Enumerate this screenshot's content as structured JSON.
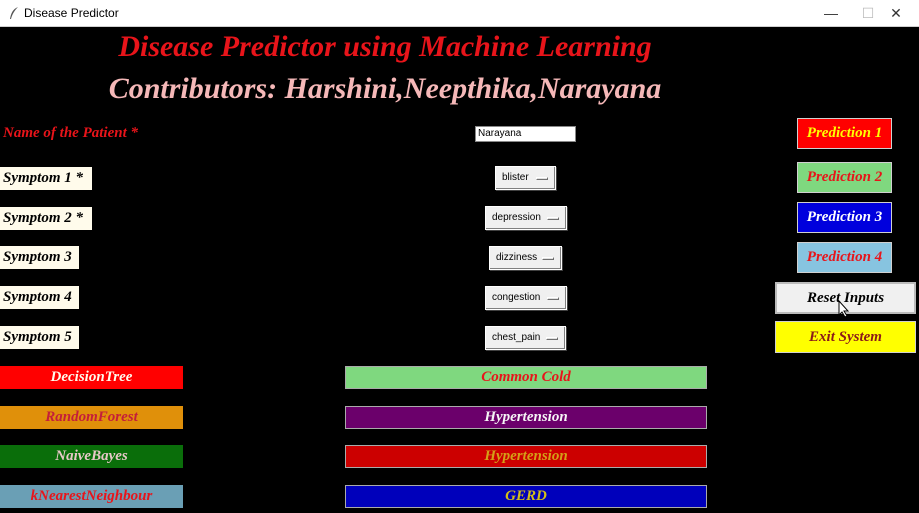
{
  "window": {
    "title": "Disease Predictor",
    "minimize": "—",
    "maximize": "☐",
    "close": "✕"
  },
  "header": {
    "title": "Disease Predictor using Machine Learning",
    "contributors": "Contributors: Harshini,Neepthika,Narayana"
  },
  "patient": {
    "label": "Name of the Patient *",
    "value": "Narayana"
  },
  "symptoms": [
    {
      "label": "Symptom 1 *",
      "value": "blister"
    },
    {
      "label": "Symptom 2 *",
      "value": "depression"
    },
    {
      "label": "Symptom 3",
      "value": "dizziness"
    },
    {
      "label": "Symptom 4",
      "value": "congestion"
    },
    {
      "label": "Symptom 5",
      "value": "chest_pain"
    }
  ],
  "algorithms": [
    {
      "label": "DecisionTree",
      "bg": "#ff0000",
      "fg": "#fffbeb"
    },
    {
      "label": "RandomForest",
      "bg": "#e0900a",
      "fg": "#c41e3a"
    },
    {
      "label": "NaiveBayes",
      "bg": "#0a6e0a",
      "fg": "#e8c8c8"
    },
    {
      "label": "kNearestNeighbour",
      "bg": "#6a9fb5",
      "fg": "#e8141a"
    }
  ],
  "results": [
    {
      "value": "Common Cold",
      "bg": "#7fd87f",
      "fg": "#e8141a"
    },
    {
      "value": "Hypertension",
      "bg": "#6b006b",
      "fg": "#f5f5f5"
    },
    {
      "value": "Hypertension",
      "bg": "#cc0000",
      "fg": "#d4a017"
    },
    {
      "value": "GERD",
      "bg": "#0000bb",
      "fg": "#d4c017"
    }
  ],
  "actions": {
    "prediction1": {
      "label": "Prediction 1",
      "bg": "#ff0000",
      "fg": "#ffff00"
    },
    "prediction2": {
      "label": "Prediction 2",
      "bg": "#7fd87f",
      "fg": "#e8141a"
    },
    "prediction3": {
      "label": "Prediction 3",
      "bg": "#0000dd",
      "fg": "#ffffff"
    },
    "prediction4": {
      "label": "Prediction 4",
      "bg": "#87c4e0",
      "fg": "#e8141a"
    },
    "reset": {
      "label": "Reset Inputs",
      "bg": "#f0f0f0",
      "fg": "#000000"
    },
    "exit": {
      "label": "Exit System",
      "bg": "#ffff00",
      "fg": "#8b1a1a"
    }
  }
}
